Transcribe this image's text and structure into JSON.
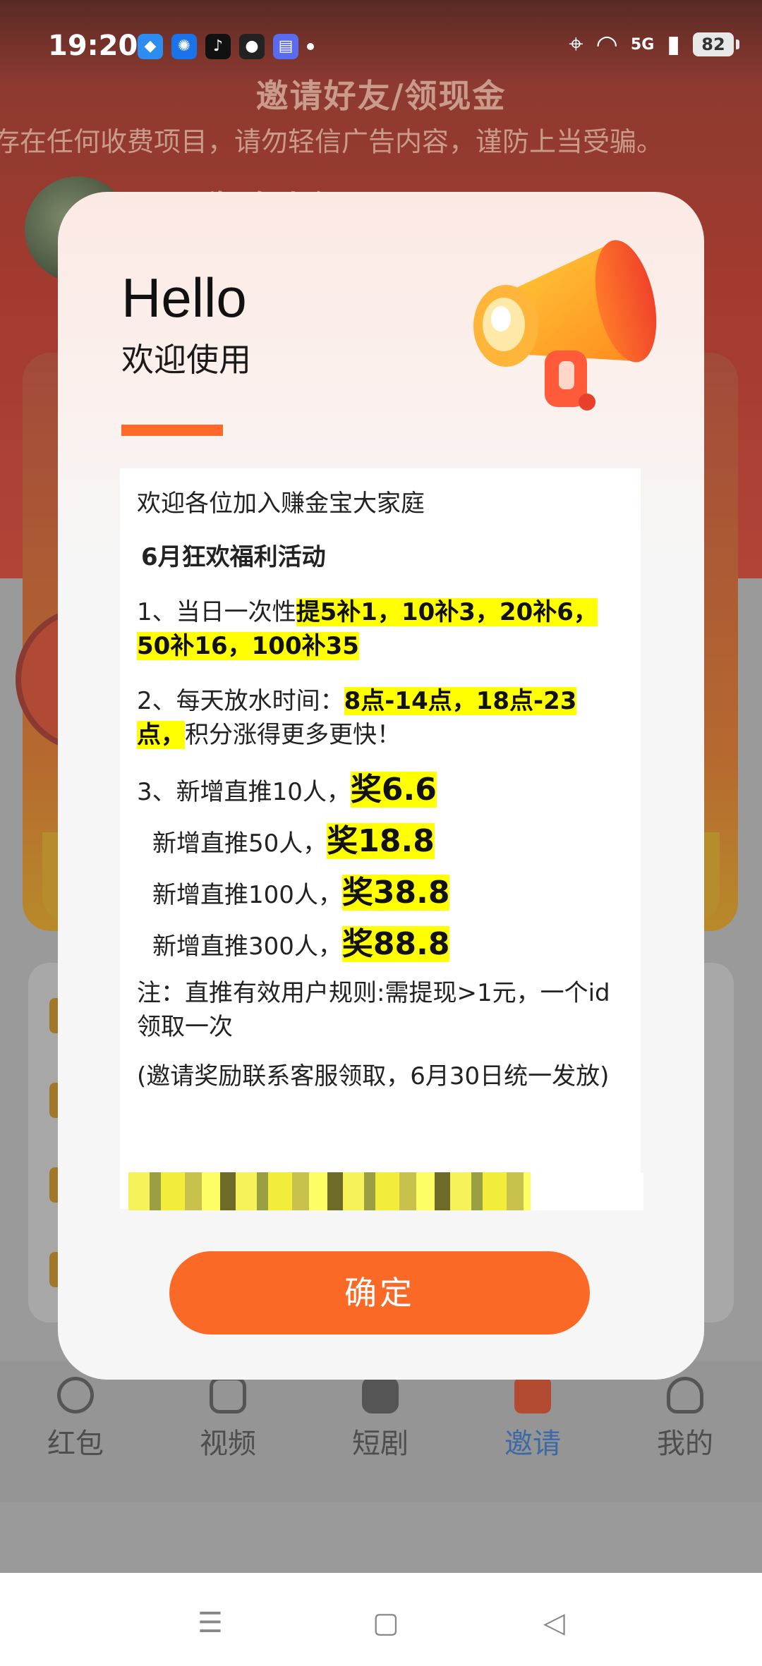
{
  "status_bar": {
    "time": "19:20",
    "network": "5G",
    "battery": "82"
  },
  "background": {
    "title": "邀请好友/领现金",
    "notice": "存在任何收费项目，请勿轻信广告内容，谨防上当受骗。",
    "username": "现稳 布上缇",
    "tabs": [
      {
        "label": "红包",
        "icon": "red-packet-icon",
        "active": false
      },
      {
        "label": "视频",
        "icon": "video-icon",
        "active": false
      },
      {
        "label": "短剧",
        "icon": "tv-icon",
        "active": false
      },
      {
        "label": "邀请",
        "icon": "gift-icon",
        "active": true
      },
      {
        "label": "我的",
        "icon": "profile-icon",
        "active": false
      }
    ]
  },
  "modal": {
    "hello": "Hello",
    "welcome": "欢迎使用",
    "intro": "欢迎各位加入赚金宝大家庭",
    "event_title": "6月狂欢福利活动",
    "rule1_prefix": "1、当日一次性",
    "rule1_highlight": "提5补1，10补3，20补6，50补16，100补35",
    "rule2_prefix": "2、每天放水时间：",
    "rule2_highlight": "8点-14点，18点-23点，",
    "rule2_suffix": "积分涨得更多更快！",
    "reward_rows": [
      {
        "text": "3、新增直推10人，",
        "reward": "奖6.6"
      },
      {
        "text": "新增直推50人，",
        "reward": "奖18.8"
      },
      {
        "text": "新增直推100人，",
        "reward": "奖38.8"
      },
      {
        "text": "新增直推300人，",
        "reward": "奖88.8"
      }
    ],
    "note": "注：直推有效用户规则:需提现>1元，一个id领取一次",
    "contact": "(邀请奖励联系客服领取，6月30日统一发放)",
    "confirm_label": "确定"
  },
  "colors": {
    "accent": "#fa6a26",
    "highlight": "#ffff00",
    "tab_active": "#3d6aa6"
  }
}
